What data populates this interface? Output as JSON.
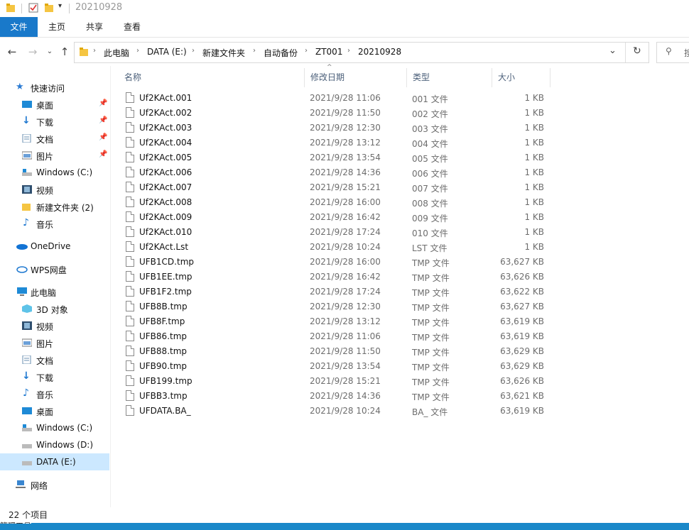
{
  "window": {
    "title": "20210928"
  },
  "ribbon": {
    "tabs": [
      "文件",
      "主页",
      "共享",
      "查看"
    ]
  },
  "breadcrumb": [
    "此电脑",
    "DATA (E:)",
    "新建文件夹",
    "自动备份",
    "ZT001",
    "20210928"
  ],
  "search": {
    "placeholder": "搜"
  },
  "sidebar": {
    "quick_access": "快速访问",
    "quick_items": [
      "桌面",
      "下载",
      "文档",
      "图片",
      "Windows (C:)",
      "视频",
      "新建文件夹 (2)",
      "音乐"
    ],
    "onedrive": "OneDrive",
    "wps": "WPS网盘",
    "this_pc": "此电脑",
    "pc_items": [
      "3D 对象",
      "视频",
      "图片",
      "文档",
      "下载",
      "音乐",
      "桌面",
      "Windows (C:)",
      "Windows (D:)",
      "DATA (E:)"
    ],
    "network": "网络"
  },
  "columns": {
    "name": "名称",
    "date": "修改日期",
    "type": "类型",
    "size": "大小"
  },
  "files": [
    {
      "name": "Uf2KAct.001",
      "date": "2021/9/28 11:06",
      "type": "001 文件",
      "size": "1 KB"
    },
    {
      "name": "Uf2KAct.002",
      "date": "2021/9/28 11:50",
      "type": "002 文件",
      "size": "1 KB"
    },
    {
      "name": "Uf2KAct.003",
      "date": "2021/9/28 12:30",
      "type": "003 文件",
      "size": "1 KB"
    },
    {
      "name": "Uf2KAct.004",
      "date": "2021/9/28 13:12",
      "type": "004 文件",
      "size": "1 KB"
    },
    {
      "name": "Uf2KAct.005",
      "date": "2021/9/28 13:54",
      "type": "005 文件",
      "size": "1 KB"
    },
    {
      "name": "Uf2KAct.006",
      "date": "2021/9/28 14:36",
      "type": "006 文件",
      "size": "1 KB"
    },
    {
      "name": "Uf2KAct.007",
      "date": "2021/9/28 15:21",
      "type": "007 文件",
      "size": "1 KB"
    },
    {
      "name": "Uf2KAct.008",
      "date": "2021/9/28 16:00",
      "type": "008 文件",
      "size": "1 KB"
    },
    {
      "name": "Uf2KAct.009",
      "date": "2021/9/28 16:42",
      "type": "009 文件",
      "size": "1 KB"
    },
    {
      "name": "Uf2KAct.010",
      "date": "2021/9/28 17:24",
      "type": "010 文件",
      "size": "1 KB"
    },
    {
      "name": "Uf2KAct.Lst",
      "date": "2021/9/28 10:24",
      "type": "LST 文件",
      "size": "1 KB"
    },
    {
      "name": "UFB1CD.tmp",
      "date": "2021/9/28 16:00",
      "type": "TMP 文件",
      "size": "63,627 KB"
    },
    {
      "name": "UFB1EE.tmp",
      "date": "2021/9/28 16:42",
      "type": "TMP 文件",
      "size": "63,626 KB"
    },
    {
      "name": "UFB1F2.tmp",
      "date": "2021/9/28 17:24",
      "type": "TMP 文件",
      "size": "63,622 KB"
    },
    {
      "name": "UFB8B.tmp",
      "date": "2021/9/28 12:30",
      "type": "TMP 文件",
      "size": "63,627 KB"
    },
    {
      "name": "UFB8F.tmp",
      "date": "2021/9/28 13:12",
      "type": "TMP 文件",
      "size": "63,619 KB"
    },
    {
      "name": "UFB86.tmp",
      "date": "2021/9/28 11:06",
      "type": "TMP 文件",
      "size": "63,619 KB"
    },
    {
      "name": "UFB88.tmp",
      "date": "2021/9/28 11:50",
      "type": "TMP 文件",
      "size": "63,629 KB"
    },
    {
      "name": "UFB90.tmp",
      "date": "2021/9/28 13:54",
      "type": "TMP 文件",
      "size": "63,629 KB"
    },
    {
      "name": "UFB199.tmp",
      "date": "2021/9/28 15:21",
      "type": "TMP 文件",
      "size": "63,626 KB"
    },
    {
      "name": "UFBB3.tmp",
      "date": "2021/9/28 14:36",
      "type": "TMP 文件",
      "size": "63,621 KB"
    },
    {
      "name": "UFDATA.BA_",
      "date": "2021/9/28 10:24",
      "type": "BA_ 文件",
      "size": "63,619 KB"
    }
  ],
  "status": {
    "count": "22 个项目"
  },
  "taskbar": {
    "text": "管理工具"
  }
}
